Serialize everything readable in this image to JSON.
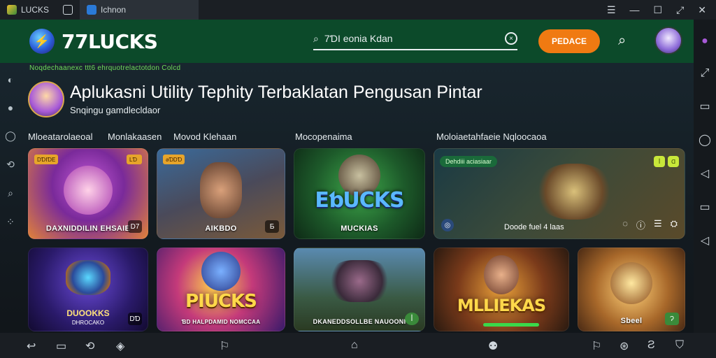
{
  "window": {
    "tabs": [
      {
        "label": "LUCKS"
      },
      {
        "label": ""
      },
      {
        "label": "Ichnon"
      }
    ],
    "controls": {
      "menu": "☰",
      "minimize": "—",
      "maximize": "☐",
      "restore": "⤢",
      "close": "✕"
    }
  },
  "header": {
    "brand": "77LUCKS",
    "search_value": "7ƊI eonia Kdan",
    "cta_label": "PEDACE"
  },
  "ticker": "Noqdechaanexc ttt6 ehrquotrelactotdon Colcd",
  "hero": {
    "title": "Aplukasni Utility Tephity Terbaklatan Pengusan Pintar",
    "subtitle": "Snqingu gamdlecldaor"
  },
  "categories": [
    "Mloeatarolaeoal",
    "Monlakaasen",
    "Movod Klehaan",
    "Mocopenaima",
    "Moloiaetahfaeie Nqloocaoa"
  ],
  "cards": {
    "c1": {
      "badge_tl": "DƊIƊE",
      "badge_tr": "LƊ",
      "caption": "DAXNIDDILIN EHSAIE",
      "corner": "D7"
    },
    "c2": {
      "badge_tl": "ǝƊDƊ",
      "caption": "AIKBDO",
      "corner": "Ƃ"
    },
    "c3": {
      "big": "EƅUCKS",
      "caption": "MUCKIAS"
    },
    "c4": {
      "header": "Dehdiii aciasiaar",
      "pill1": "ꟾ",
      "pill2": "Ɑ",
      "caption": "Doode fuel 4 laas",
      "icons": [
        "◌",
        "ⓘ",
        "☰",
        "⛭"
      ],
      "left_icon": "◎"
    },
    "c5": {
      "title": "DUOOKKS",
      "subtitle": "DHROCAKO",
      "corner": "DƊ"
    },
    "c6": {
      "big": "PIUCKS",
      "caption": "ƁD HALPDAMID NOMCCAA"
    },
    "c7": {
      "caption": "DKANEDDSOLLBE NAUOONI",
      "corner": "ꟾ"
    },
    "c8": {
      "big": "MLLIEKAS"
    },
    "c9": {
      "caption": "Sbeel",
      "corner": "Ɂ"
    }
  },
  "rails": {
    "left": [
      "◐",
      "●",
      "◯",
      "⟲",
      "⌕",
      "⁘"
    ],
    "right": [
      "●",
      "⤢",
      "▭",
      "◯",
      "◁",
      "▭",
      "◁"
    ]
  },
  "bottom_nav": [
    "↩",
    "▭",
    "⟲",
    "◈",
    "⚐",
    "⌂",
    "⚉",
    "⚐",
    "⊛",
    "Ƨ",
    "⛉"
  ]
}
